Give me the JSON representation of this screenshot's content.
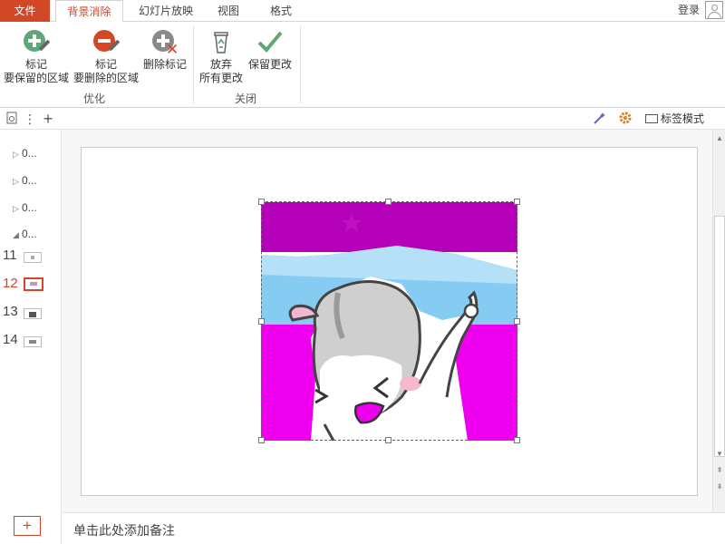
{
  "tabs": {
    "file": "文件",
    "background_removal": "背景消除",
    "slideshow": "幻灯片放映",
    "view": "视图",
    "format": "格式"
  },
  "account": {
    "login": "登录"
  },
  "ribbon": {
    "optimize": {
      "label": "优化",
      "mark_keep_line1": "标记",
      "mark_keep_line2": "要保留的区域",
      "mark_remove_line1": "标记",
      "mark_remove_line2": "要删除的区域",
      "delete_mark": "删除标记"
    },
    "close": {
      "label": "关闭",
      "discard_line1": "放弃",
      "discard_line2": "所有更改",
      "keep_changes": "保留更改"
    }
  },
  "toolbar2": {
    "tag_mode": "标签模式",
    "add": "+",
    "more": "⋮"
  },
  "sections": [
    {
      "label": "0..."
    },
    {
      "label": "0..."
    },
    {
      "label": "0..."
    },
    {
      "label": "0..."
    }
  ],
  "slides": [
    {
      "number": "11"
    },
    {
      "number": "12"
    },
    {
      "number": "13"
    },
    {
      "number": "14"
    }
  ],
  "add_slide": "+",
  "notes": {
    "placeholder": "单击此处添加备注"
  },
  "colors": {
    "accent": "#d24726",
    "keep_green": "#5fa777",
    "removal_magenta": "#ee00ee",
    "removal_purple": "#b400b8",
    "sky_blue": "#86cbf2"
  }
}
